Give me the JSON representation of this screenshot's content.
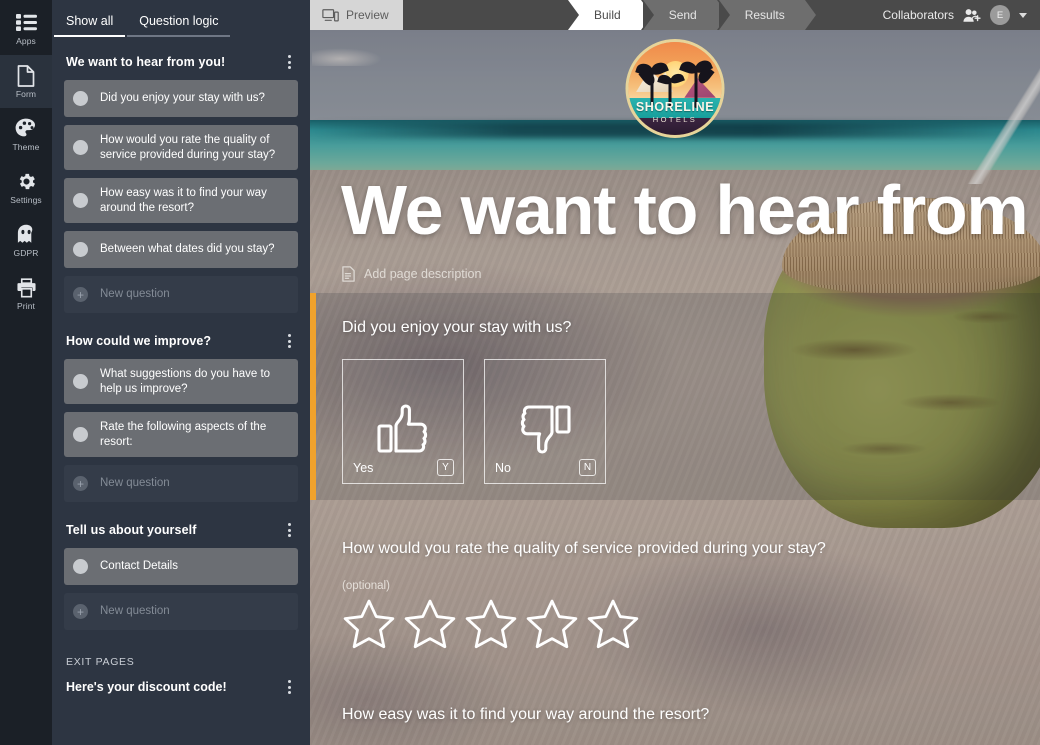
{
  "rail": {
    "items": [
      {
        "label": "Apps",
        "icon": "apps-icon",
        "active": false
      },
      {
        "label": "Form",
        "icon": "form-icon",
        "active": true
      },
      {
        "label": "Theme",
        "icon": "theme-icon",
        "active": false
      },
      {
        "label": "Settings",
        "icon": "settings-icon",
        "active": false
      },
      {
        "label": "GDPR",
        "icon": "ghost-icon",
        "active": false
      },
      {
        "label": "Print",
        "icon": "print-icon",
        "active": false
      }
    ]
  },
  "panel": {
    "tabs": [
      {
        "label": "Show all",
        "active": true
      },
      {
        "label": "Question logic",
        "active": false
      }
    ],
    "sections": [
      {
        "title": "We want to hear from you!",
        "questions": [
          {
            "text": "Did you enjoy your stay with us?",
            "empty": false
          },
          {
            "text": "How would you rate the quality of service provided during your stay?",
            "empty": false
          },
          {
            "text": "How easy was it to find your way around the resort?",
            "empty": false
          },
          {
            "text": "Between what dates did you stay?",
            "empty": false
          },
          {
            "text": "New question",
            "empty": true
          }
        ]
      },
      {
        "title": "How could we improve?",
        "questions": [
          {
            "text": "What suggestions do you have to help us improve?",
            "empty": false
          },
          {
            "text": "Rate the following aspects of the resort:",
            "empty": false
          },
          {
            "text": "New question",
            "empty": true
          }
        ]
      },
      {
        "title": "Tell us about yourself",
        "questions": [
          {
            "text": "Contact Details",
            "empty": false
          },
          {
            "text": "New question",
            "empty": true
          }
        ]
      }
    ],
    "exit": {
      "label": "EXIT PAGES",
      "page_title": "Here's your discount code!"
    }
  },
  "topbar": {
    "preview_label": "Preview",
    "steps": [
      {
        "label": "Build",
        "active": true
      },
      {
        "label": "Send",
        "active": false
      },
      {
        "label": "Results",
        "active": false
      }
    ],
    "collaborators_label": "Collaborators",
    "avatar_initial": "E"
  },
  "form": {
    "logo": {
      "brand": "SHORELINE",
      "sub": "HOTELS"
    },
    "hero_title": "We want to hear from you!",
    "page_description_placeholder": "Add page description",
    "questions": [
      {
        "title": "Did you enjoy your stay with us?",
        "type": "yes-no",
        "choices": [
          {
            "label": "Yes",
            "key": "Y",
            "icon": "thumbs-up-icon"
          },
          {
            "label": "No",
            "key": "N",
            "icon": "thumbs-down-icon"
          }
        ]
      },
      {
        "title": "How would you rate the quality of service provided during your stay?",
        "type": "star-rating",
        "optional_label": "(optional)",
        "star_count": 5,
        "selected": 0
      },
      {
        "title": "How easy was it to find your way around the resort?",
        "type": "text"
      }
    ]
  },
  "colors": {
    "accent": "#f0a22c",
    "rail_bg": "#1b2027",
    "panel_bg": "#2d3542",
    "card_bg": "#6b6e73",
    "topbar_bg": "#4a4a4a"
  }
}
